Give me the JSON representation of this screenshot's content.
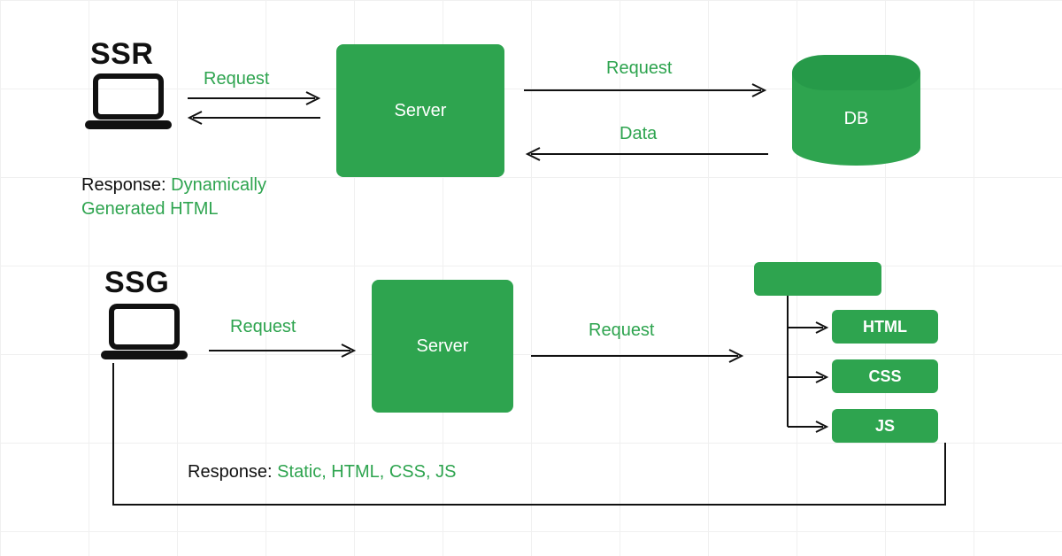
{
  "ssr": {
    "title": "SSR",
    "request_label": "Request",
    "server_label": "Server",
    "db_label": "DB",
    "db_request_label": "Request",
    "db_data_label": "Data",
    "response_key": "Response: ",
    "response_value": "Dynamically Generated HTML"
  },
  "ssg": {
    "title": "SSG",
    "request_label": "Request",
    "server_label": "Server",
    "assets_request_label": "Request",
    "assets": {
      "html": "HTML",
      "css": "CSS",
      "js": "JS"
    },
    "response_key": "Response: ",
    "response_value": "Static, HTML, CSS, JS"
  },
  "colors": {
    "accent": "#2ea44f",
    "arrow": "#111"
  }
}
